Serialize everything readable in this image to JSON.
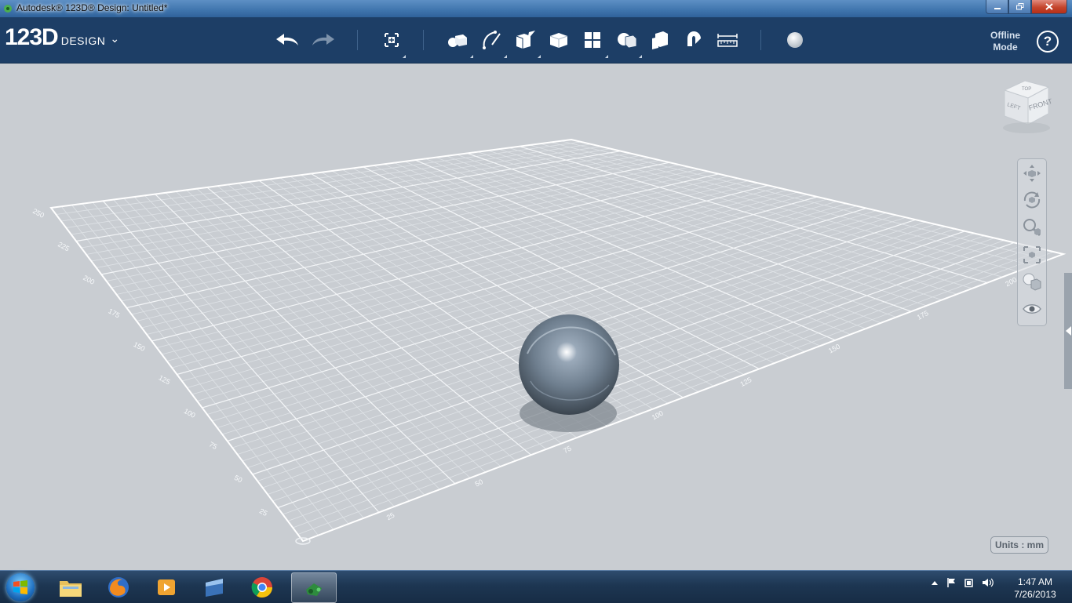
{
  "window": {
    "title": "Autodesk® 123D® Design: Untitled*"
  },
  "app": {
    "logo_number": "123D",
    "logo_text": "DESIGN",
    "logo_chevron": "⌄"
  },
  "toolbar": {
    "undo_icon": "undo-arrow-icon",
    "redo_icon": "redo-arrow-icon",
    "offline_line1": "Offline",
    "offline_line2": "Mode",
    "help_label": "?"
  },
  "viewcube": {
    "front_label": "FRONT",
    "left_label": "LEFT",
    "top_label": "TOP"
  },
  "grid": {
    "left_axis_labels": [
      "25",
      "50",
      "75",
      "100",
      "125",
      "150",
      "175",
      "200",
      "225",
      "250"
    ],
    "bottom_axis_labels": [
      "25",
      "50",
      "75",
      "100",
      "125",
      "150",
      "175",
      "200"
    ]
  },
  "status": {
    "units": "Units : mm"
  },
  "taskbar": {
    "time": "1:47 AM",
    "date": "7/26/2013"
  },
  "colors": {
    "toolbar_bg": "#1d3e66",
    "viewport_bg": "#c9cdd2",
    "grid_line": "#ffffff",
    "sphere": "#6f7f8f"
  }
}
